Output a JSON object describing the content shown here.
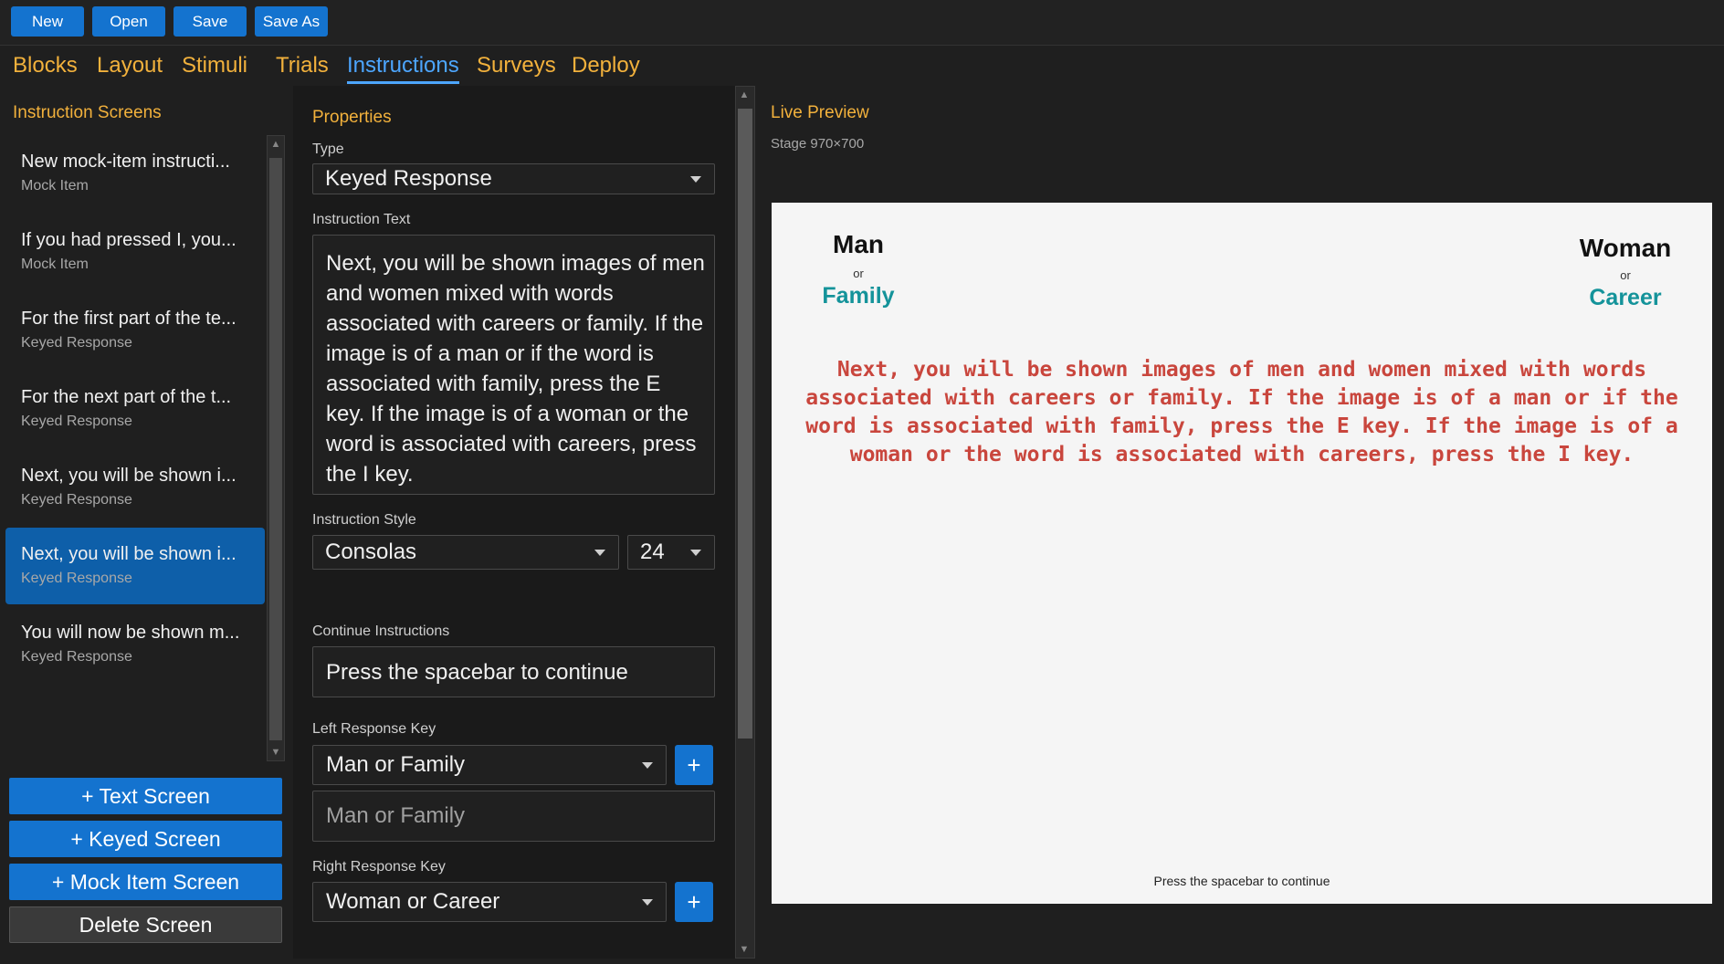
{
  "toolbar": {
    "new": "New",
    "open": "Open",
    "save": "Save",
    "save_as": "Save As"
  },
  "nav": {
    "tabs": [
      "Blocks",
      "Layout",
      "Stimuli",
      "Trials",
      "Instructions",
      "Surveys",
      "Deploy"
    ],
    "active": "Instructions"
  },
  "left": {
    "title": "Instruction Screens",
    "items": [
      {
        "title": "New mock-item instructi...",
        "type": "Mock Item"
      },
      {
        "title": "If you had pressed I, you...",
        "type": "Mock Item"
      },
      {
        "title": "For the first part of the te...",
        "type": "Keyed Response"
      },
      {
        "title": "For the next part of the t...",
        "type": "Keyed Response"
      },
      {
        "title": "Next, you will be shown i...",
        "type": "Keyed Response"
      },
      {
        "title": "Next, you will be shown i...",
        "type": "Keyed Response"
      },
      {
        "title": "You will now be shown m...",
        "type": "Keyed Response"
      }
    ],
    "selected_index": 5,
    "buttons": {
      "text_screen": "+ Text Screen",
      "keyed_screen": "+ Keyed Screen",
      "mock_screen": "+ Mock Item Screen",
      "delete_screen": "Delete Screen"
    }
  },
  "props": {
    "title": "Properties",
    "type_label": "Type",
    "type_value": "Keyed Response",
    "text_label": "Instruction Text",
    "text_value": "Next, you will be shown images of men and women mixed with words associated with careers or family. If the image is of a man or if the word is associated with family, press the E key. If the image is of a woman or the word is associated with careers, press the I key.",
    "style_label": "Instruction Style",
    "font_value": "Consolas",
    "size_value": "24",
    "swatches": [
      "#000000",
      "#ffffff",
      "#d12b2e",
      "#16a6c0",
      "#0f8f6f",
      "#5a3f94",
      "#f0359a",
      "#e8614f",
      "#e36a5e"
    ],
    "continue_label": "Continue Instructions",
    "continue_value": "Press the spacebar to continue",
    "left_key_label": "Left Response Key",
    "left_key_value": "Man or Family",
    "left_key_text": "Man or Family",
    "right_key_label": "Right Response Key",
    "right_key_value": "Woman or Career",
    "plus": "+"
  },
  "preview": {
    "title": "Live Preview",
    "stage_label": "Stage 970×700",
    "left_cat": "Man",
    "left_or": "or",
    "left_alt": "Family",
    "right_cat": "Woman",
    "right_or": "or",
    "right_alt": "Career",
    "text": "Next, you will be shown images of men and women mixed with words associated with careers or family. If the image is of a man or if the word is associated with family, press the E key. If the image is of a woman or the word is associated with careers, press the I key.",
    "continue": "Press the spacebar to continue"
  },
  "colors": {
    "accent": "#1473cf",
    "tab_active": "#4da6ff",
    "tab_inactive": "#f2b13c",
    "stage_text": "#c9463d",
    "category_alt": "#14939a"
  }
}
